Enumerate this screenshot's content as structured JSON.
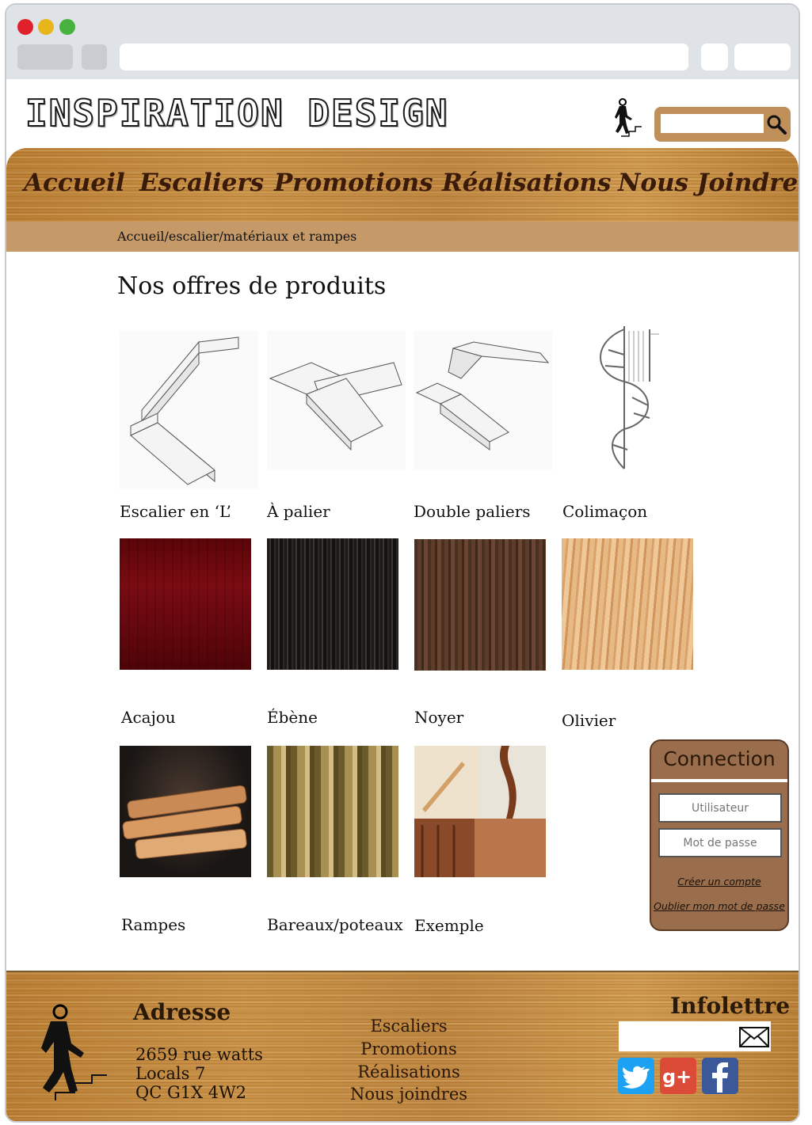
{
  "header": {
    "logo_text": "INSPIRATION DESIGN",
    "search_placeholder": ""
  },
  "nav": {
    "items": [
      "Accueil",
      "Escaliers",
      "Promotions",
      "Réalisations",
      "Nous Joindre"
    ]
  },
  "breadcrumb": "Accueil/escalier/matériaux et rampes",
  "main": {
    "title": "Nos offres de produits",
    "products": [
      {
        "label": "Escalier en ‘L’",
        "image": "l-shaped-staircase"
      },
      {
        "label": "À palier",
        "image": "landing-staircase"
      },
      {
        "label": "Double paliers",
        "image": "double-landing-staircase"
      },
      {
        "label": "Colimaçon",
        "image": "spiral-staircase"
      },
      {
        "label": "Acajou",
        "image": "mahogany-wood"
      },
      {
        "label": "Ébène",
        "image": "ebony-wood"
      },
      {
        "label": "Noyer",
        "image": "walnut-wood"
      },
      {
        "label": "Olivier",
        "image": "olive-wood"
      },
      {
        "label": "Rampes",
        "image": "handrails"
      },
      {
        "label": "Bareaux/poteaux",
        "image": "balusters"
      },
      {
        "label": "Exemple",
        "image": "staircase-examples"
      }
    ]
  },
  "login": {
    "title": "Connection",
    "username_placeholder": "Utilisateur",
    "password_placeholder": "Mot de passe",
    "create_account": "Créer un compte",
    "forgot_password": "Oublier mon mot de passe"
  },
  "footer": {
    "address_heading": "Adresse",
    "address_lines": [
      "2659 rue watts",
      "Locals 7",
      "QC G1X 4W2"
    ],
    "links": [
      "Escaliers",
      "Promotions",
      "Réalisations",
      "Nous joindres"
    ],
    "newsletter_heading": "Infolettre",
    "social": [
      "twitter-icon",
      "google-plus-icon",
      "facebook-icon"
    ]
  },
  "colors": {
    "wood": "#c0883e",
    "breadcrumb_bar": "#c69a68",
    "login_panel": "#9a6e4c",
    "twitter": "#1da1f2",
    "google_plus": "#dc4a38",
    "facebook": "#3b5998"
  }
}
